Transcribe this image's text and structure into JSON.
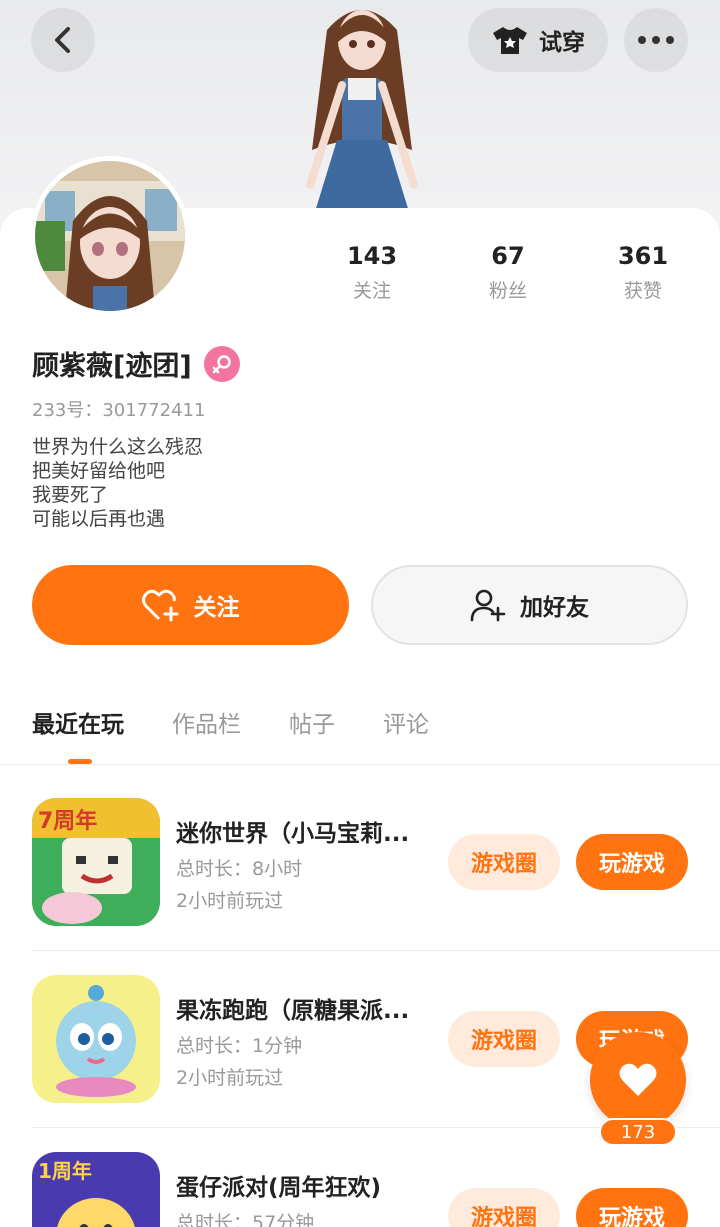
{
  "header": {
    "try_on_label": "试穿"
  },
  "profile": {
    "name": "顾紫薇[迹团]",
    "uid": "233号：301772411",
    "bio": [
      "世界为什么这么残忍",
      "把美好留给他吧",
      "我要死了",
      "可能以后再也遇"
    ],
    "gender_icon": "female-icon",
    "stats": [
      {
        "value": "143",
        "label": "关注"
      },
      {
        "value": "67",
        "label": "粉丝"
      },
      {
        "value": "361",
        "label": "获赞"
      }
    ]
  },
  "actions": {
    "follow_label": "关注",
    "add_friend_label": "加好友"
  },
  "tabs": [
    {
      "label": "最近在玩",
      "active": true
    },
    {
      "label": "作品栏",
      "active": false
    },
    {
      "label": "帖子",
      "active": false
    },
    {
      "label": "评论",
      "active": false
    }
  ],
  "games": [
    {
      "title": "迷你世界（小马宝莉...",
      "duration": "总时长：8小时",
      "last_played": "2小时前玩过",
      "icon_badge": "7周年",
      "circle_label": "游戏圈",
      "play_label": "玩游戏"
    },
    {
      "title": "果冻跑跑（原糖果派...",
      "duration": "总时长：1分钟",
      "last_played": "2小时前玩过",
      "circle_label": "游戏圈",
      "play_label": "玩游戏"
    },
    {
      "title": "蛋仔派对(周年狂欢)",
      "duration": "总时长：57分钟",
      "last_played": "",
      "icon_badge": "1周年",
      "circle_label": "游戏圈",
      "play_label": "玩游戏"
    }
  ],
  "like_fab": {
    "count": "173"
  },
  "colors": {
    "accent": "#ff7310",
    "accent_light": "#ffeadc",
    "gender_pink": "#f3749c"
  }
}
